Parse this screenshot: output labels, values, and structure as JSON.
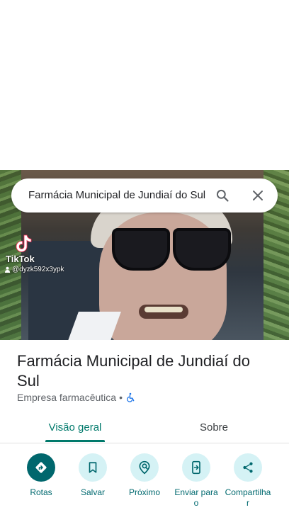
{
  "search": {
    "query": "Farmácia Municipal de Jundiaí do Sul"
  },
  "overlay": {
    "brand": "TikTok",
    "handle": "@dyzk592x3ypk"
  },
  "place": {
    "title": "Farmácia Municipal de Jundiaí do Sul",
    "category": "Empresa farmacêutica",
    "separator": "•"
  },
  "tabs": [
    {
      "label": "Visão geral",
      "active": true
    },
    {
      "label": "Sobre",
      "active": false
    }
  ],
  "actions": [
    {
      "label": "Rotas",
      "icon": "directions-icon"
    },
    {
      "label": "Salvar",
      "icon": "bookmark-icon"
    },
    {
      "label": "Próximo",
      "icon": "nearby-icon"
    },
    {
      "label": "Enviar para\no",
      "icon": "send-to-phone-icon"
    },
    {
      "label": "Compartilha\nr",
      "icon": "share-icon"
    }
  ],
  "colors": {
    "accent": "#00796b",
    "action_primary": "#00676d",
    "action_secondary_bg": "#d5f2f5",
    "accessibility": "#1a73e8"
  }
}
